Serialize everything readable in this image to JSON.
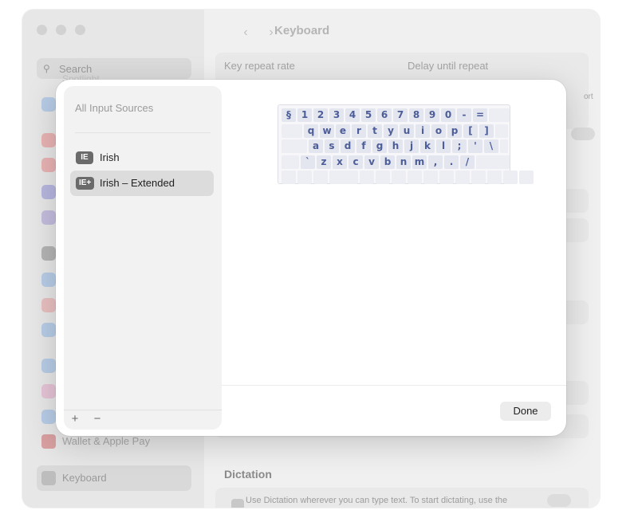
{
  "background_window": {
    "search_placeholder": "Search",
    "sidebar_hidden_item": "Spotlight",
    "sidebar_items": [
      "Wallet & Apple Pay",
      "Keyboard"
    ],
    "title": "Keyboard",
    "key_repeat_label": "Key repeat rate",
    "delay_label": "Delay until repeat",
    "short_label": "ort",
    "dictation_title": "Dictation",
    "dictation_desc": "Use Dictation wherever you can type text. To start dictating, use the"
  },
  "modal": {
    "all_sources_label": "All Input Sources",
    "sources": [
      {
        "badge": "IE",
        "label": "Irish",
        "selected": false
      },
      {
        "badge": "IE+",
        "label": "Irish – Extended",
        "selected": true
      }
    ],
    "add_label": "+",
    "remove_label": "−",
    "done_label": "Done",
    "keyboard_rows": [
      [
        "§",
        "1",
        "2",
        "3",
        "4",
        "5",
        "6",
        "7",
        "8",
        "9",
        "0",
        "-",
        "=",
        ""
      ],
      [
        "",
        "q",
        "w",
        "e",
        "r",
        "t",
        "y",
        "u",
        "i",
        "o",
        "p",
        "[",
        "]",
        ""
      ],
      [
        "",
        "a",
        "s",
        "d",
        "f",
        "g",
        "h",
        "j",
        "k",
        "l",
        ";",
        "'",
        "\\",
        ""
      ],
      [
        "",
        "`",
        "z",
        "x",
        "c",
        "v",
        "b",
        "n",
        "m",
        ",",
        ".",
        "/",
        ""
      ],
      [
        "",
        "",
        "",
        "",
        "",
        "",
        "",
        "",
        "",
        "",
        "",
        "",
        "",
        "",
        ""
      ]
    ]
  }
}
